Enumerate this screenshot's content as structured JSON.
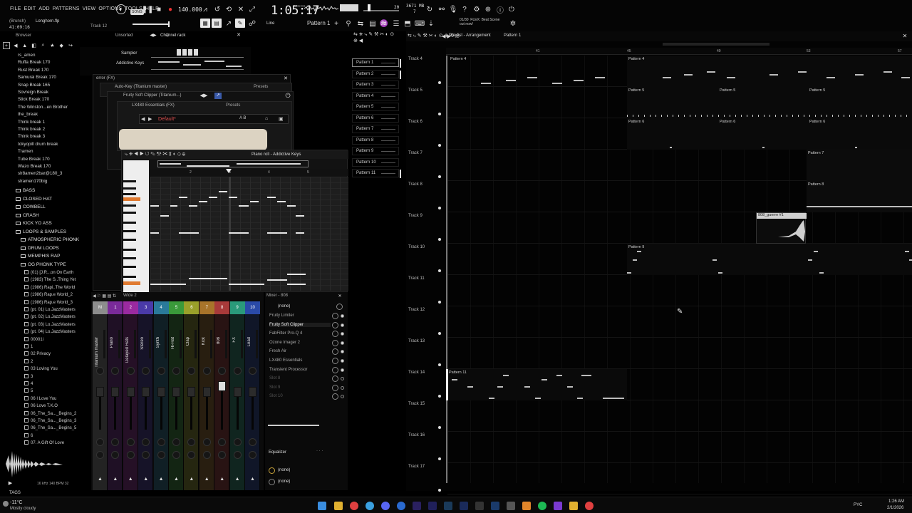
{
  "menu": [
    "FILE",
    "EDIT",
    "ADD",
    "PATTERNS",
    "VIEW",
    "OPTIONS",
    "TOOLS",
    "HELP"
  ],
  "toolbar": {
    "song_label": "SONG",
    "tempo": "140.000",
    "time": "1:05:17",
    "time_unit": "M:S:CS",
    "cpu": "3671 MB",
    "cpu_sub": "7",
    "poly": "20",
    "pattern": "Pattern 1",
    "snap": "Line",
    "news": "01/30  FLEX: Beat Scene\nout now!",
    "project": "Longhorn.flp",
    "time_small": "41:09:16",
    "track_hint": "Track 12",
    "hint_prefix": "(Brunch)"
  },
  "browser": {
    "title": "Browser",
    "items": [
      "rs_amen",
      "Ruffa Break 170",
      "Rust Break 170",
      "Samurai Break 170",
      "Snap Break 165",
      "Sovreign Break",
      "Stick Break 170",
      "The Winston...en Brother",
      "the_break",
      "Think break 1",
      "Think break 2",
      "Think break 3",
      "tokyopill drum break",
      "Tramen",
      "Tube Break 170",
      "Wazo Break 170",
      "slr8amen2bar@180_3",
      "slramen170big"
    ],
    "folders": [
      "BASS",
      "CLOSED HAT",
      "COWBELL",
      "CRASH",
      "KICK YO ASS",
      "LOOPS & SAMPLES"
    ],
    "subfolders": [
      "ATMOSPHERIC PHONK",
      "DRUM LOOPS",
      "MEMPHIS RAP",
      "OG PHONK TYPE"
    ],
    "files": [
      "(01) [J.R...on On Earth",
      "(1983) The S..Thing Yet",
      "(1986) Rapi..The World",
      "(1986) Rap.e World_2",
      "(1986) Rap.e World_3",
      "(pt. 01) Lo.JazzMasters",
      "(pt. 02) Lo.JazzMasters",
      "(pt. 03) Lo.JazzMasters",
      "(pt. 04) Lo.JazzMasters",
      "00001i",
      "1",
      "02 Privacy",
      "2",
      "03 Loving You",
      "3",
      "4",
      "5",
      "06 I Love You",
      "06 Love T.K.O",
      "06_The_Sa..._Begins_2",
      "06_The_Sa..._Begins_3",
      "06_The_Sa..._Begins_5",
      "6",
      "07. A Gift Of Love"
    ],
    "footer_info": "16 kHz 140 BPM 32",
    "tags_label": "TAGS"
  },
  "channel_rack": {
    "title": "Unsorted",
    "name": "Channel rack",
    "channels": [
      "Sampler",
      "Addictive Keys"
    ]
  },
  "plugins": {
    "error_title": "error (FX)",
    "autokey_title": "Auto-Key (Titanium master)",
    "presets_label": "Presets",
    "clipper_title": "Fruity Soft Clipper (Titanium...)",
    "lx_title": "LX480 Essentials (FX)",
    "default_preset": "Default*"
  },
  "piano_roll": {
    "title": "Piano roll - Addictive Keys"
  },
  "pattern_list": [
    "Pattern 1",
    "Pattern 2",
    "Pattern 3",
    "Pattern 4",
    "Pattern 5",
    "Pattern 6",
    "Pattern 7",
    "Pattern 8",
    "Pattern 9",
    "Pattern 10",
    "Pattern 11"
  ],
  "mixer": {
    "title": "Mixer - 808",
    "width_label": "Wide 2",
    "strips": [
      {
        "num": "M",
        "name": "Titanium master",
        "color": "#8d8d8d"
      },
      {
        "num": "1",
        "name": "Piano",
        "color": "#7a2a9a"
      },
      {
        "num": "2",
        "name": "Delayed Hats",
        "color": "#9a2aa0"
      },
      {
        "num": "3",
        "name": "Stereo",
        "color": "#4a3aa8"
      },
      {
        "num": "4",
        "name": "Synth",
        "color": "#2a7a9a"
      },
      {
        "num": "5",
        "name": "Hi-Hat",
        "color": "#3a9a3a"
      },
      {
        "num": "6",
        "name": "Clap",
        "color": "#9aa02a"
      },
      {
        "num": "7",
        "name": "Kick",
        "color": "#a8742a"
      },
      {
        "num": "8",
        "name": "808",
        "color": "#a83a3a"
      },
      {
        "num": "9",
        "name": "FX",
        "color": "#2a9a7a"
      },
      {
        "num": "10",
        "name": "Lead",
        "color": "#2a4aa8"
      }
    ],
    "input": "(none)",
    "inserts": [
      "Fruity Limiter",
      "Fruity Soft Clipper",
      "FabFilter Pro-Q 4",
      "Ozone Imager 2",
      "Fresh Air",
      "LX480 Essentials",
      "Transient Processor",
      "Slot 8",
      "Slot 9",
      "Slot 10"
    ],
    "eq_label": "Equalizer",
    "out1": "(none)",
    "out2": "(none)"
  },
  "playlist": {
    "title": "Playlist - Arrangement",
    "pattern": "Pattern 1",
    "tracks": [
      "Track 4",
      "Track 5",
      "Track 6",
      "Track 7",
      "Track 8",
      "Track 9",
      "Track 10",
      "Track 11",
      "Track 12",
      "Track 13",
      "Track 14",
      "Track 15",
      "Track 16",
      "Track 17"
    ],
    "clips": {
      "p4": "Pattern 4",
      "p5": "Pattern 5",
      "p6": "Pattern 6",
      "p7": "Pattern 7",
      "p8": "Pattern 8",
      "p9": "Pattern 9",
      "p11": "Pattern 11",
      "audio": "808_guerre #1"
    }
  },
  "weather": {
    "temp": "-11°C",
    "desc": "Mostly cloudy"
  },
  "taskbar": {
    "lang": "PYC",
    "time": "1:26 AM",
    "date": "2/1/2026"
  }
}
